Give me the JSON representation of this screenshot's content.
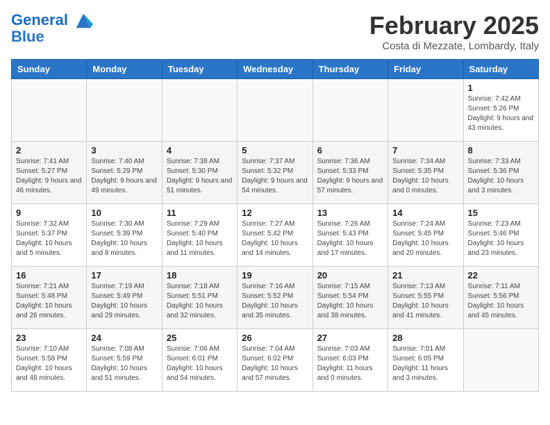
{
  "header": {
    "logo_line1": "General",
    "logo_line2": "Blue",
    "month": "February 2025",
    "location": "Costa di Mezzate, Lombardy, Italy"
  },
  "weekdays": [
    "Sunday",
    "Monday",
    "Tuesday",
    "Wednesday",
    "Thursday",
    "Friday",
    "Saturday"
  ],
  "weeks": [
    [
      {
        "day": "",
        "info": ""
      },
      {
        "day": "",
        "info": ""
      },
      {
        "day": "",
        "info": ""
      },
      {
        "day": "",
        "info": ""
      },
      {
        "day": "",
        "info": ""
      },
      {
        "day": "",
        "info": ""
      },
      {
        "day": "1",
        "info": "Sunrise: 7:42 AM\nSunset: 5:26 PM\nDaylight: 9 hours and 43 minutes."
      }
    ],
    [
      {
        "day": "2",
        "info": "Sunrise: 7:41 AM\nSunset: 5:27 PM\nDaylight: 9 hours and 46 minutes."
      },
      {
        "day": "3",
        "info": "Sunrise: 7:40 AM\nSunset: 5:29 PM\nDaylight: 9 hours and 49 minutes."
      },
      {
        "day": "4",
        "info": "Sunrise: 7:38 AM\nSunset: 5:30 PM\nDaylight: 9 hours and 51 minutes."
      },
      {
        "day": "5",
        "info": "Sunrise: 7:37 AM\nSunset: 5:32 PM\nDaylight: 9 hours and 54 minutes."
      },
      {
        "day": "6",
        "info": "Sunrise: 7:36 AM\nSunset: 5:33 PM\nDaylight: 9 hours and 57 minutes."
      },
      {
        "day": "7",
        "info": "Sunrise: 7:34 AM\nSunset: 5:35 PM\nDaylight: 10 hours and 0 minutes."
      },
      {
        "day": "8",
        "info": "Sunrise: 7:33 AM\nSunset: 5:36 PM\nDaylight: 10 hours and 3 minutes."
      }
    ],
    [
      {
        "day": "9",
        "info": "Sunrise: 7:32 AM\nSunset: 5:37 PM\nDaylight: 10 hours and 5 minutes."
      },
      {
        "day": "10",
        "info": "Sunrise: 7:30 AM\nSunset: 5:39 PM\nDaylight: 10 hours and 8 minutes."
      },
      {
        "day": "11",
        "info": "Sunrise: 7:29 AM\nSunset: 5:40 PM\nDaylight: 10 hours and 11 minutes."
      },
      {
        "day": "12",
        "info": "Sunrise: 7:27 AM\nSunset: 5:42 PM\nDaylight: 10 hours and 14 minutes."
      },
      {
        "day": "13",
        "info": "Sunrise: 7:26 AM\nSunset: 5:43 PM\nDaylight: 10 hours and 17 minutes."
      },
      {
        "day": "14",
        "info": "Sunrise: 7:24 AM\nSunset: 5:45 PM\nDaylight: 10 hours and 20 minutes."
      },
      {
        "day": "15",
        "info": "Sunrise: 7:23 AM\nSunset: 5:46 PM\nDaylight: 10 hours and 23 minutes."
      }
    ],
    [
      {
        "day": "16",
        "info": "Sunrise: 7:21 AM\nSunset: 5:48 PM\nDaylight: 10 hours and 26 minutes."
      },
      {
        "day": "17",
        "info": "Sunrise: 7:19 AM\nSunset: 5:49 PM\nDaylight: 10 hours and 29 minutes."
      },
      {
        "day": "18",
        "info": "Sunrise: 7:18 AM\nSunset: 5:51 PM\nDaylight: 10 hours and 32 minutes."
      },
      {
        "day": "19",
        "info": "Sunrise: 7:16 AM\nSunset: 5:52 PM\nDaylight: 10 hours and 35 minutes."
      },
      {
        "day": "20",
        "info": "Sunrise: 7:15 AM\nSunset: 5:54 PM\nDaylight: 10 hours and 38 minutes."
      },
      {
        "day": "21",
        "info": "Sunrise: 7:13 AM\nSunset: 5:55 PM\nDaylight: 10 hours and 41 minutes."
      },
      {
        "day": "22",
        "info": "Sunrise: 7:11 AM\nSunset: 5:56 PM\nDaylight: 10 hours and 45 minutes."
      }
    ],
    [
      {
        "day": "23",
        "info": "Sunrise: 7:10 AM\nSunset: 5:58 PM\nDaylight: 10 hours and 48 minutes."
      },
      {
        "day": "24",
        "info": "Sunrise: 7:08 AM\nSunset: 5:59 PM\nDaylight: 10 hours and 51 minutes."
      },
      {
        "day": "25",
        "info": "Sunrise: 7:06 AM\nSunset: 6:01 PM\nDaylight: 10 hours and 54 minutes."
      },
      {
        "day": "26",
        "info": "Sunrise: 7:04 AM\nSunset: 6:02 PM\nDaylight: 10 hours and 57 minutes."
      },
      {
        "day": "27",
        "info": "Sunrise: 7:03 AM\nSunset: 6:03 PM\nDaylight: 11 hours and 0 minutes."
      },
      {
        "day": "28",
        "info": "Sunrise: 7:01 AM\nSunset: 6:05 PM\nDaylight: 11 hours and 3 minutes."
      },
      {
        "day": "",
        "info": ""
      }
    ]
  ]
}
